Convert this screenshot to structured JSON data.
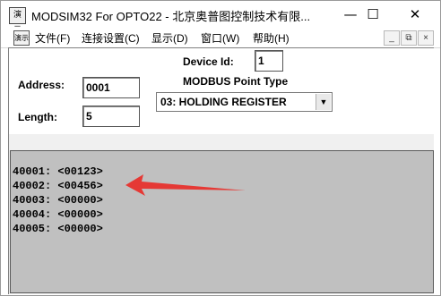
{
  "window": {
    "title": "MODSIM32 For OPTO22 - 北京奥普图控制技术有限...",
    "app_icon_text": "演示",
    "controls": {
      "minimize": "—",
      "maximize": "☐",
      "close": "✕"
    }
  },
  "menu": {
    "icon_text": "演示",
    "items": [
      "文件(F)",
      "连接设置(C)",
      "显示(D)",
      "窗口(W)",
      "帮助(H)"
    ],
    "mdi_controls": {
      "minimize": "_",
      "restore": "⧉",
      "close": "×"
    }
  },
  "form": {
    "device_id_label": "Device Id:",
    "device_id_value": "1",
    "point_type_label": "MODBUS Point Type",
    "point_type_selected": "03: HOLDING REGISTER",
    "address_label": "Address:",
    "address_value": "0001",
    "length_label": "Length:",
    "length_value": "5"
  },
  "registers": [
    "40001: <00123>",
    "40002: <00456>",
    "40003: <00000>",
    "40004: <00000>",
    "40005: <00000>"
  ],
  "colors": {
    "data_background": "#c0c0c0",
    "annotation_arrow": "#e53935"
  }
}
